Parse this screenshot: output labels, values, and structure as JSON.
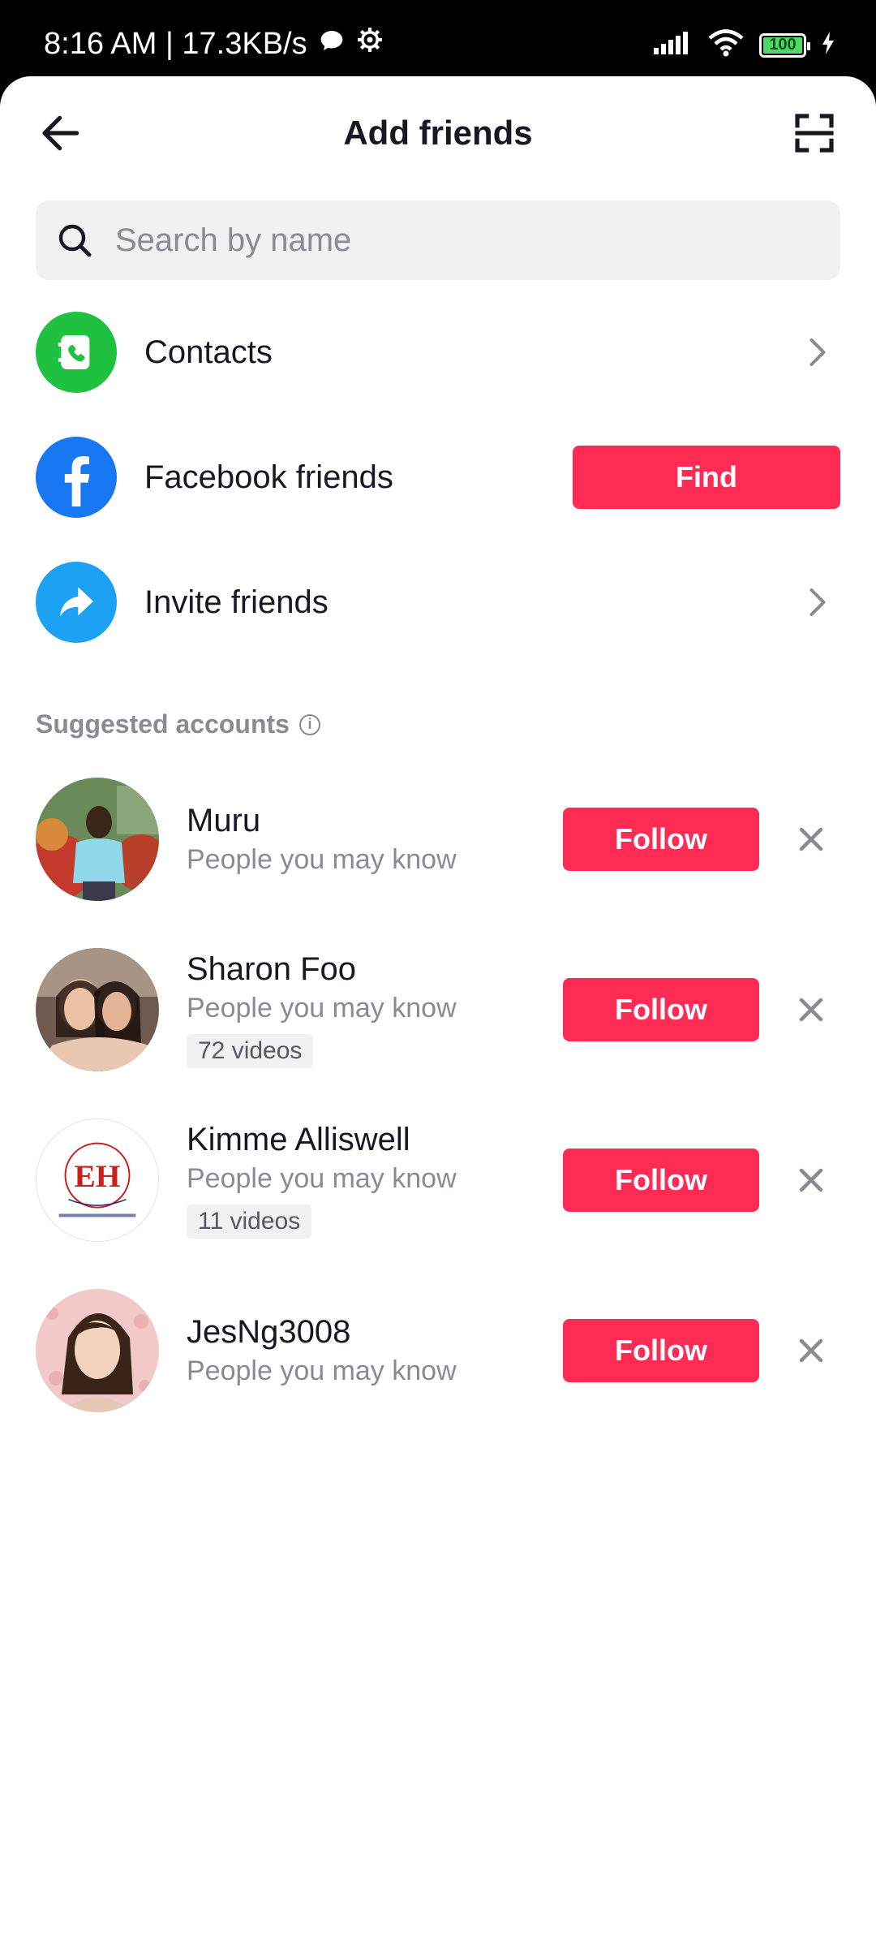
{
  "status_bar": {
    "time": "8:16 AM | 17.3KB/s",
    "battery": "100"
  },
  "header": {
    "title": "Add friends"
  },
  "search": {
    "placeholder": "Search by name"
  },
  "options": [
    {
      "label": "Contacts",
      "icon": "contacts-icon",
      "color": "#20c040"
    },
    {
      "label": "Facebook friends",
      "icon": "facebook-icon",
      "color": "#1877f2",
      "action": "Find"
    },
    {
      "label": "Invite friends",
      "icon": "share-arrow-icon",
      "color": "#1da1f2"
    }
  ],
  "suggested": {
    "title": "Suggested accounts",
    "accounts": [
      {
        "name": "Muru",
        "subtitle": "People you may know",
        "badge": "",
        "follow": "Follow"
      },
      {
        "name": "Sharon Foo",
        "subtitle": "People you may know",
        "badge": "72 videos",
        "follow": "Follow"
      },
      {
        "name": "Kimme Alliswell",
        "subtitle": "People you may know",
        "badge": "11 videos",
        "follow": "Follow",
        "avatar_logo": "EH"
      },
      {
        "name": "JesNg3008",
        "subtitle": "People you may know",
        "badge": "",
        "follow": "Follow"
      }
    ]
  },
  "colors": {
    "accent": "#fe2c55",
    "muted_text": "#8a8b91",
    "search_bg": "#f1f1f2"
  }
}
